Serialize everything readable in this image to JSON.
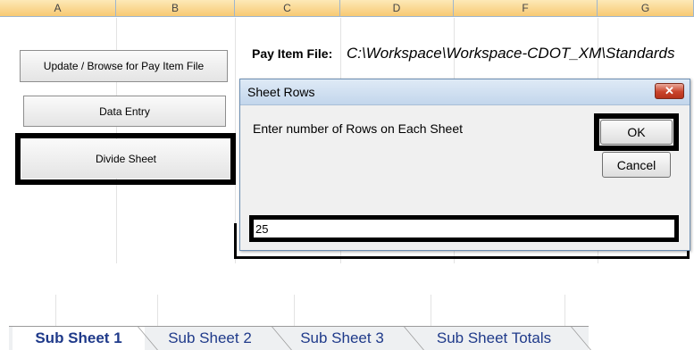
{
  "columns": [
    "A",
    "B",
    "C",
    "D",
    "E",
    "F",
    "G"
  ],
  "buttons": {
    "update": "Update / Browse for Pay Item File",
    "data_entry": "Data Entry",
    "divide_sheet": "Divide Sheet"
  },
  "pay_item": {
    "label": "Pay Item File:",
    "path": "C:\\Workspace\\Workspace-CDOT_XM\\Standards"
  },
  "dialog": {
    "title": "Sheet Rows",
    "prompt": "Enter number of Rows on Each Sheet",
    "ok_label": "OK",
    "cancel_label": "Cancel",
    "input_value": "25",
    "close_glyph": "✕"
  },
  "tabs": [
    "Sub Sheet 1",
    "Sub Sheet 2",
    "Sub Sheet 3",
    "Sub Sheet Totals"
  ],
  "colors": {
    "header_gradient_top": "#fde9b7",
    "header_gradient_bottom": "#f7c973",
    "tab_text": "#1f3a8a",
    "close_button": "#c9432b"
  }
}
